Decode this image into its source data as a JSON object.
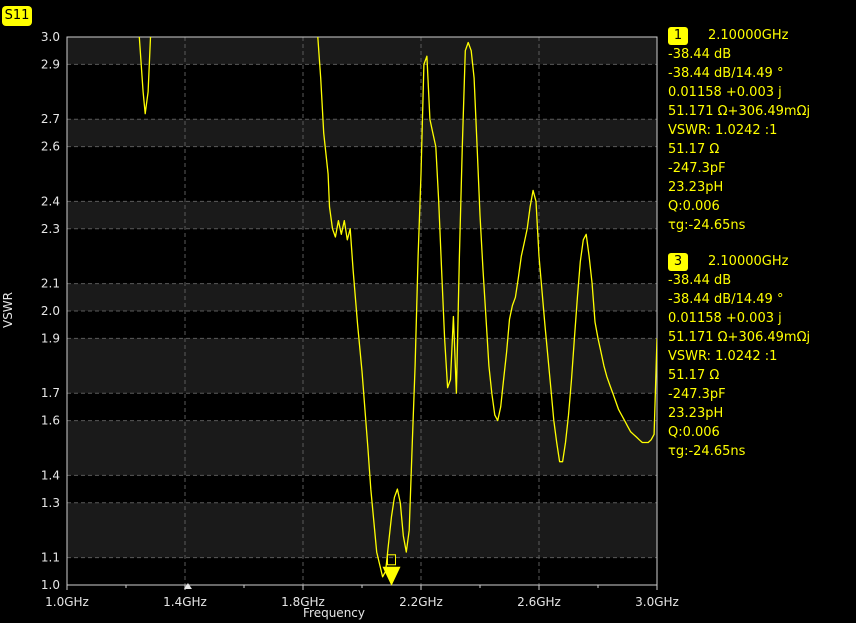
{
  "trace": {
    "name": "S11",
    "color": "#ffff00"
  },
  "markers": [
    {
      "id": "1",
      "freq": "2.10000GHz",
      "lines": [
        "-38.44 dB",
        "-38.44 dB/14.49 °",
        "0.01158 +0.003 j",
        "51.171 Ω+306.49mΩj",
        "VSWR: 1.0242 :1",
        "51.17 Ω",
        "-247.3pF",
        "23.23pH",
        "Q:0.006",
        "τg:-24.65ns"
      ]
    },
    {
      "id": "3",
      "freq": "2.10000GHz",
      "lines": [
        "-38.44 dB",
        "-38.44 dB/14.49 °",
        "0.01158 +0.003 j",
        "51.171 Ω+306.49mΩj",
        "VSWR: 1.0242 :1",
        "51.17 Ω",
        "-247.3pF",
        "23.23pH",
        "Q:0.006",
        "τg:-24.65ns"
      ]
    }
  ],
  "chart_data": {
    "type": "line",
    "xlabel": "Frequency",
    "ylabel": "VSWR",
    "xlim": [
      1.0,
      3.0
    ],
    "ylim": [
      1.0,
      3.0
    ],
    "x_ticks": [
      1.0,
      1.4,
      1.8,
      2.2,
      2.6,
      3.0
    ],
    "x_tick_labels": [
      "1.0GHz",
      "1.4GHz",
      "1.8GHz",
      "2.2GHz",
      "2.6GHz",
      "3.0GHz"
    ],
    "y_ticks": [
      1.0,
      1.1,
      1.3,
      1.4,
      1.6,
      1.7,
      1.9,
      2.0,
      2.1,
      2.3,
      2.4,
      2.6,
      2.7,
      2.9,
      3.0
    ],
    "y_tick_labels": [
      "1.0",
      "1.1",
      "1.3",
      "1.4",
      "1.6",
      "1.7",
      "1.9",
      "2.0",
      "2.1",
      "2.3",
      "2.4",
      "2.6",
      "2.7",
      "2.9",
      "3.0"
    ],
    "grid": true,
    "series": [
      {
        "x": [
          1.245,
          1.258,
          1.265,
          1.275,
          1.283,
          1.85,
          1.86,
          1.87,
          1.885,
          1.89,
          1.9,
          1.91,
          1.92,
          1.93,
          1.94,
          1.95,
          1.96,
          1.97,
          1.985,
          2.0,
          2.02,
          2.03,
          2.05,
          2.07,
          2.08,
          2.09,
          2.1,
          2.11,
          2.12,
          2.13,
          2.14,
          2.15,
          2.16,
          2.17,
          2.18,
          2.19,
          2.2,
          2.21,
          2.22,
          2.23,
          2.24,
          2.25,
          2.26,
          2.27,
          2.28,
          2.29,
          2.3,
          2.31,
          2.32,
          2.33,
          2.34,
          2.35,
          2.36,
          2.37,
          2.38,
          2.39,
          2.4,
          2.41,
          2.42,
          2.43,
          2.44,
          2.45,
          2.46,
          2.47,
          2.48,
          2.49,
          2.5,
          2.51,
          2.52,
          2.53,
          2.54,
          2.55,
          2.56,
          2.57,
          2.58,
          2.59,
          2.6,
          2.62,
          2.64,
          2.65,
          2.66,
          2.67,
          2.68,
          2.69,
          2.7,
          2.71,
          2.72,
          2.73,
          2.74,
          2.75,
          2.76,
          2.77,
          2.78,
          2.79,
          2.8,
          2.81,
          2.82,
          2.83,
          2.84,
          2.85,
          2.86,
          2.87,
          2.88,
          2.89,
          2.9,
          2.91,
          2.92,
          2.93,
          2.94,
          2.95,
          2.96,
          2.97,
          2.98,
          2.99,
          3.0
        ],
        "y": [
          3.0,
          2.8,
          2.72,
          2.8,
          3.0,
          3.0,
          2.85,
          2.65,
          2.5,
          2.38,
          2.3,
          2.27,
          2.33,
          2.28,
          2.33,
          2.26,
          2.3,
          2.15,
          1.95,
          1.78,
          1.5,
          1.35,
          1.12,
          1.03,
          1.05,
          1.15,
          1.25,
          1.32,
          1.35,
          1.3,
          1.18,
          1.12,
          1.2,
          1.5,
          1.8,
          2.2,
          2.5,
          2.9,
          2.93,
          2.7,
          2.65,
          2.6,
          2.4,
          2.15,
          1.9,
          1.72,
          1.75,
          1.98,
          1.7,
          2.2,
          2.6,
          2.95,
          2.98,
          2.95,
          2.85,
          2.6,
          2.35,
          2.15,
          1.98,
          1.8,
          1.7,
          1.62,
          1.6,
          1.65,
          1.75,
          1.85,
          1.97,
          2.02,
          2.05,
          2.12,
          2.2,
          2.25,
          2.3,
          2.38,
          2.44,
          2.4,
          2.2,
          1.95,
          1.72,
          1.6,
          1.52,
          1.45,
          1.45,
          1.52,
          1.62,
          1.75,
          1.9,
          2.05,
          2.18,
          2.26,
          2.28,
          2.2,
          2.1,
          1.96,
          1.9,
          1.85,
          1.8,
          1.76,
          1.73,
          1.7,
          1.67,
          1.64,
          1.62,
          1.6,
          1.58,
          1.56,
          1.55,
          1.54,
          1.53,
          1.52,
          1.52,
          1.52,
          1.53,
          1.55,
          1.9
        ]
      }
    ]
  }
}
